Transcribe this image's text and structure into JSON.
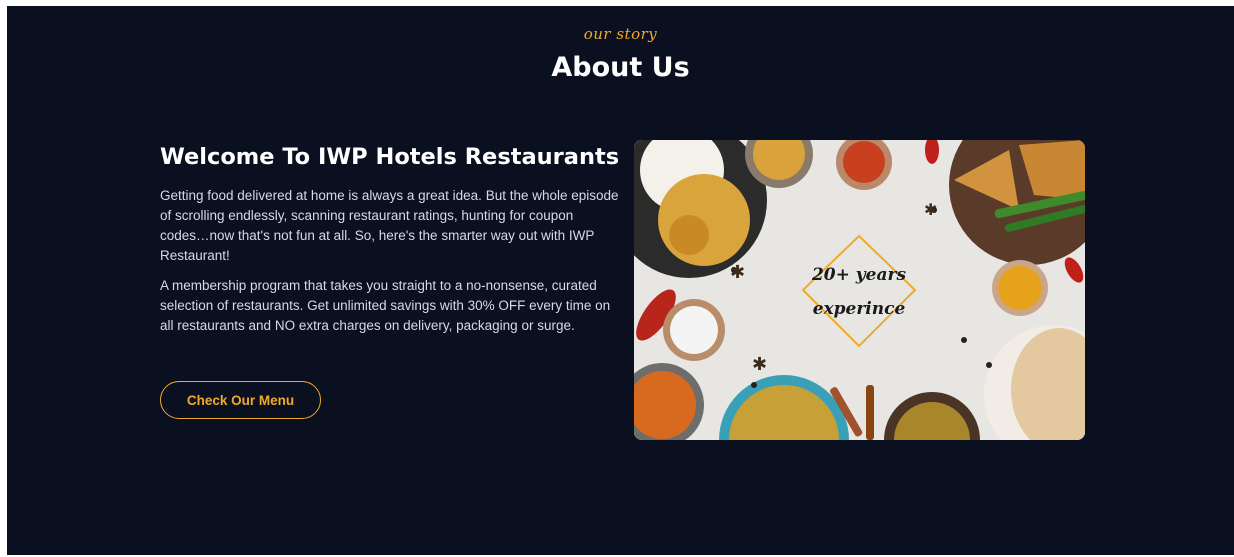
{
  "section": {
    "eyebrow": "our story",
    "title": "About Us"
  },
  "about": {
    "heading": "Welcome To IWP Hotels Restaurants",
    "paragraph_1": "Getting food delivered at home is always a great idea. But the whole episode of scrolling endlessly, scanning restaurant ratings, hunting for coupon codes…now that's not fun at all. So, here's the smarter way out with IWP Restaurant!",
    "paragraph_2": "A membership program that takes you straight to a no-nonsense, curated selection of restaurants. Get unlimited savings with 30% OFF every time on all restaurants and NO extra charges on delivery, packaging or surge.",
    "menu_button_label": "Check Our Menu"
  },
  "image": {
    "badge_line_1": "20+ years",
    "badge_line_2": "experince"
  },
  "colors": {
    "background": "#0b1020",
    "accent": "#f0a92b",
    "text_primary": "#ffffff",
    "text_secondary": "#d7dae3"
  }
}
